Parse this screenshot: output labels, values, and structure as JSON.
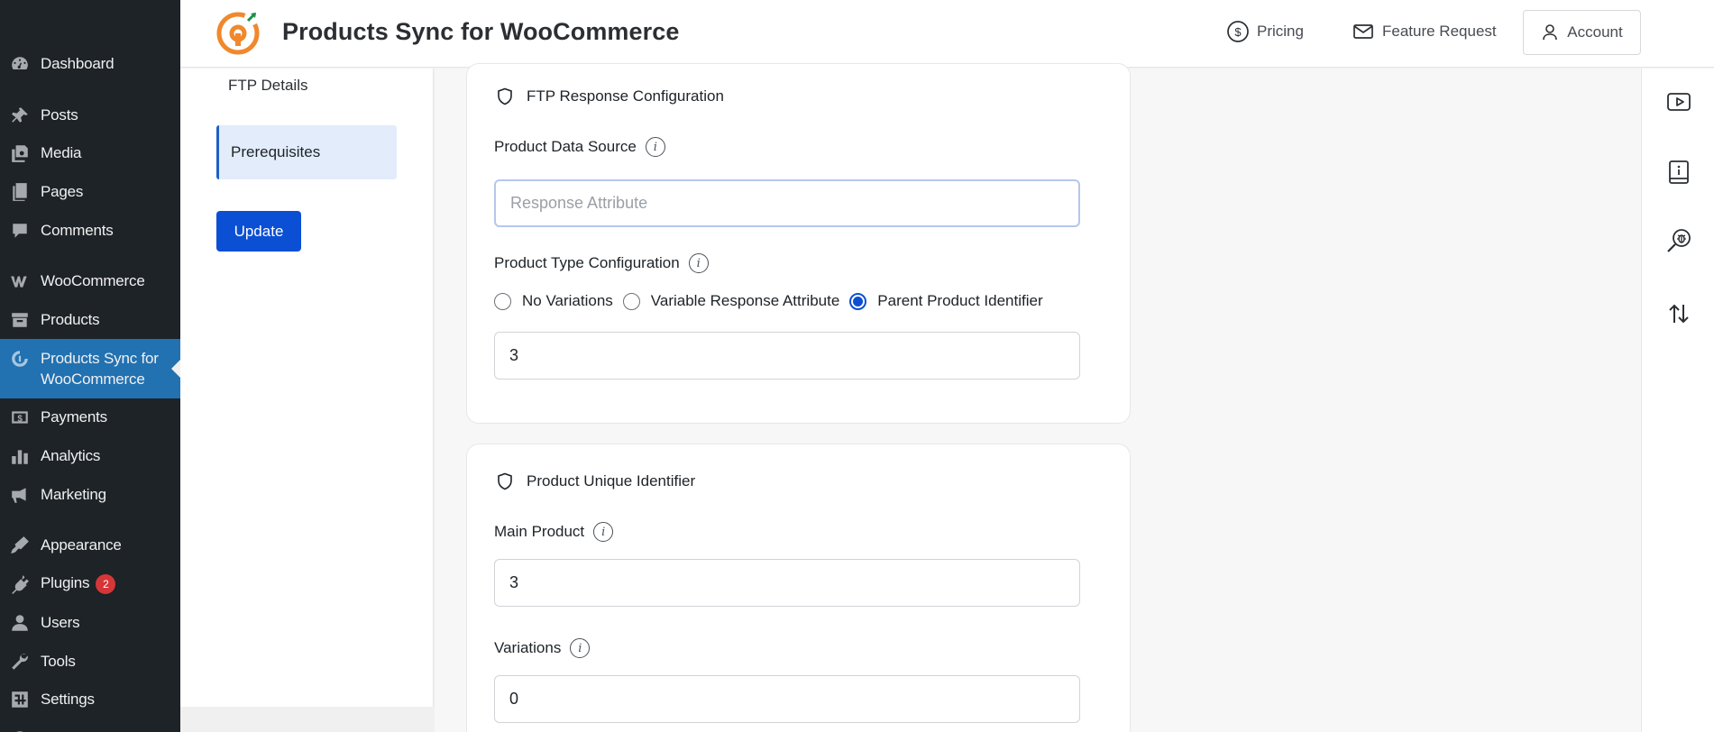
{
  "sidebar": {
    "items": [
      {
        "label": "Dashboard",
        "icon": "dashboard-icon"
      },
      {
        "label": "Posts",
        "icon": "pin-icon"
      },
      {
        "label": "Media",
        "icon": "media-icon"
      },
      {
        "label": "Pages",
        "icon": "pages-icon"
      },
      {
        "label": "Comments",
        "icon": "comment-icon"
      },
      {
        "label": "WooCommerce",
        "icon": "woocommerce-icon"
      },
      {
        "label": "Products",
        "icon": "archive-icon"
      },
      {
        "label": "Products Sync for WooCommerce",
        "icon": "sync-logo-icon",
        "current": true
      },
      {
        "label": "Payments",
        "icon": "dollar-icon"
      },
      {
        "label": "Analytics",
        "icon": "bar-chart-icon"
      },
      {
        "label": "Marketing",
        "icon": "megaphone-icon"
      },
      {
        "label": "Appearance",
        "icon": "brush-icon"
      },
      {
        "label": "Plugins",
        "icon": "plug-icon",
        "badge": "2"
      },
      {
        "label": "Users",
        "icon": "user-icon"
      },
      {
        "label": "Tools",
        "icon": "wrench-icon"
      },
      {
        "label": "Settings",
        "icon": "settings-icon"
      }
    ]
  },
  "header": {
    "title": "Products Sync for WooCommerce",
    "pricing": "Pricing",
    "feature_request": "Feature Request",
    "account": "Account"
  },
  "subnav": {
    "ftp_details": "FTP Details",
    "prerequisites": "Prerequisites",
    "update": "Update"
  },
  "ftp_card": {
    "title": "FTP Response Configuration",
    "data_source_label": "Product Data Source",
    "data_source_placeholder": "Response Attribute",
    "data_source_value": "",
    "type_label": "Product Type Configuration",
    "options": [
      "No Variations",
      "Variable Response Attribute",
      "Parent Product Identifier"
    ],
    "selected_option": "Parent Product Identifier",
    "parent_identifier_value": "3"
  },
  "unique_card": {
    "title": "Product Unique Identifier",
    "main_label": "Main Product",
    "main_value": "3",
    "variations_label": "Variations",
    "variations_value": "0"
  },
  "right_rail": [
    "youtube-icon",
    "documentation-icon",
    "debug-icon",
    "sort-arrows-icon"
  ],
  "colors": {
    "sidebar_bg": "#1d2327",
    "sidebar_current": "#2271b1",
    "primary": "#0b4fd4",
    "logo_orange": "#f0882d",
    "badge": "#d63638"
  }
}
